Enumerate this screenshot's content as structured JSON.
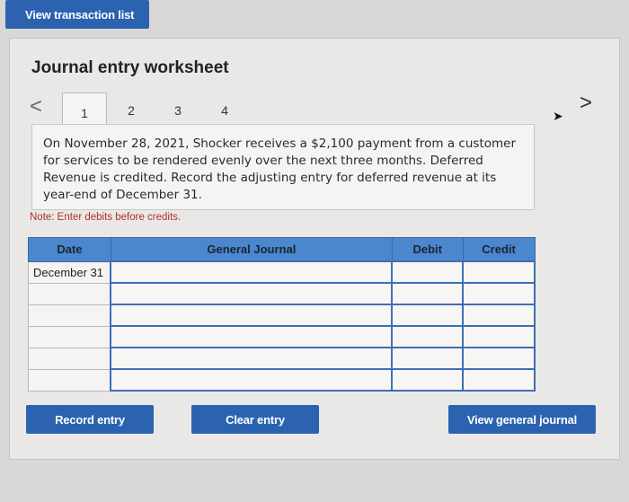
{
  "top": {
    "view_transactions_label": "View transaction list"
  },
  "worksheet": {
    "title": "Journal entry worksheet",
    "tabs": [
      "1",
      "2",
      "3",
      "4"
    ],
    "prev": "<",
    "next": ">",
    "question": "On November 28, 2021, Shocker receives a $2,100 payment from a customer for services to be rendered evenly over the next three months. Deferred Revenue is credited. Record the adjusting entry for deferred revenue at its year-end of December 31.",
    "note": "Note: Enter debits before credits."
  },
  "table": {
    "headers": {
      "date": "Date",
      "journal": "General Journal",
      "debit": "Debit",
      "credit": "Credit"
    },
    "rows": [
      {
        "date": "December 31",
        "journal": "",
        "debit": "",
        "credit": ""
      },
      {
        "date": "",
        "journal": "",
        "debit": "",
        "credit": ""
      },
      {
        "date": "",
        "journal": "",
        "debit": "",
        "credit": ""
      },
      {
        "date": "",
        "journal": "",
        "debit": "",
        "credit": ""
      },
      {
        "date": "",
        "journal": "",
        "debit": "",
        "credit": ""
      },
      {
        "date": "",
        "journal": "",
        "debit": "",
        "credit": ""
      }
    ]
  },
  "buttons": {
    "record": "Record entry",
    "clear": "Clear entry",
    "view_journal": "View general journal"
  }
}
